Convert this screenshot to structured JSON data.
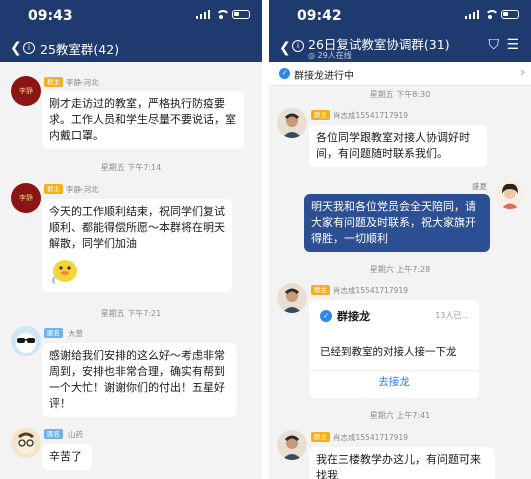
{
  "left": {
    "status_time": "09:43",
    "title": "25教室群(42)",
    "timestamps": [
      "星期五 下午7:14",
      "星期五 下午7:21"
    ],
    "messages": [
      {
        "role": "群主",
        "sender": "李静-河北",
        "text": "刚才走访过的教室，严格执行防疫要求。工作人员和学生尽量不要说话，室内戴口罩。",
        "avatar": "seal-avatar"
      },
      {
        "role": "群主",
        "sender": "李静-河北",
        "text": "今天的工作顺利结束，祝同学们复试顺利、都能得偿所愿～本群将在明天解散，同学们加油",
        "avatar": "seal-avatar"
      },
      {
        "role": "匿名",
        "sender": "大葱",
        "text": "感谢给我们安排的这么好～考虑非常周到，安排也非常合理，确实有帮到一个大忙！谢谢你们的付出！五星好评！",
        "avatar": "sunglasses-avatar"
      },
      {
        "role": "匿名",
        "sender": "山药",
        "text": "辛苦了",
        "avatar": "glasses-avatar"
      }
    ],
    "seal_text": "李静"
  },
  "right": {
    "status_time": "09:42",
    "title": "26日复试教室协调群(31)",
    "subtitle": "29人在线",
    "announcement": "群接龙进行中",
    "timestamps": [
      "星期五 下午8:30",
      "星期六 上午7:28",
      "星期六 上午7:41"
    ],
    "messages": [
      {
        "role": "群主",
        "sender": "肖志成15541717919",
        "text": "各位同学跟教室对接人协调好时间，有问题随时联系我们。"
      },
      {
        "sender": "盛夏",
        "text": "明天我和各位党员会全天陪同，请大家有问题及时联系，祝大家旗开得胜，一切顺利",
        "mine": true
      },
      {
        "role": "群主",
        "sender": "肖志成15541717919"
      },
      {
        "role": "群主",
        "sender": "肖志成15541717919",
        "text": "我在三楼教学办这儿，有问题可来找我"
      }
    ],
    "card": {
      "title": "群接龙",
      "count": "13人已...",
      "body": "已经到教室的对接人接一下龙",
      "action": "去接龙"
    }
  },
  "colors": {
    "header_bg": "#1f3a6e",
    "mine_bubble": "#2c4f94",
    "owner_badge": "#f2b01e",
    "guest_badge": "#6fb3ec",
    "link": "#2f7fe0"
  }
}
